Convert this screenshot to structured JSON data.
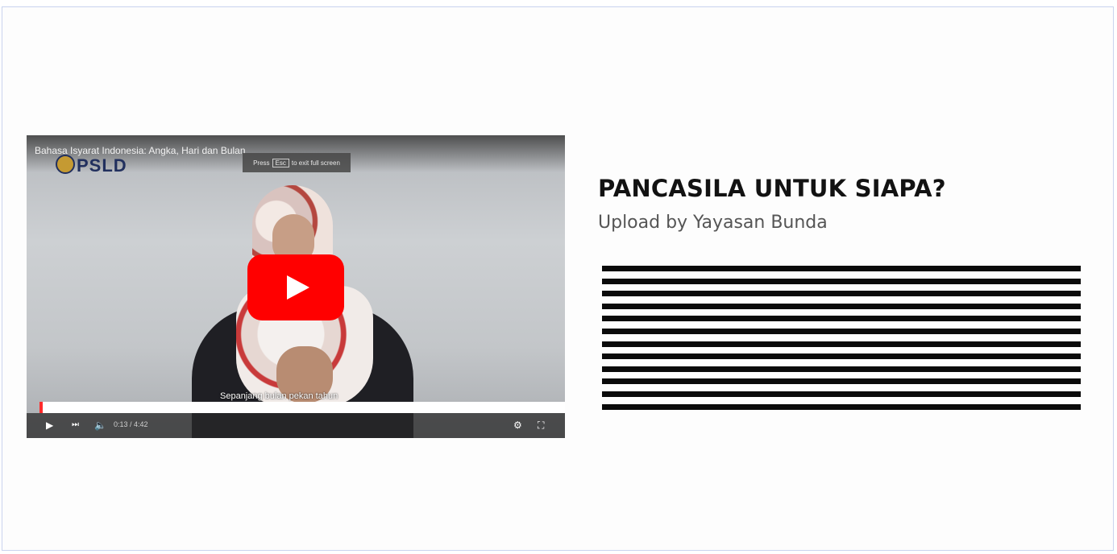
{
  "video": {
    "title": "Bahasa Isyarat Indonesia: Angka, Hari dan Bulan",
    "logo_text": "PSLD",
    "shortcut_hint": {
      "prefix": "Press",
      "key": "Esc",
      "suffix": "to exit full screen"
    },
    "caption": "Sepanjang bulan pekan tahun",
    "timecode": "0:13 / 4:42",
    "progress_fraction": 0.006,
    "play_icon": "play-icon",
    "brand_color": "#ff0000"
  },
  "info": {
    "heading": "PANCASILA UNTUK SIAPA?",
    "subheading": "Upload by Yayasan Bunda",
    "redaction_line_count": 12
  }
}
